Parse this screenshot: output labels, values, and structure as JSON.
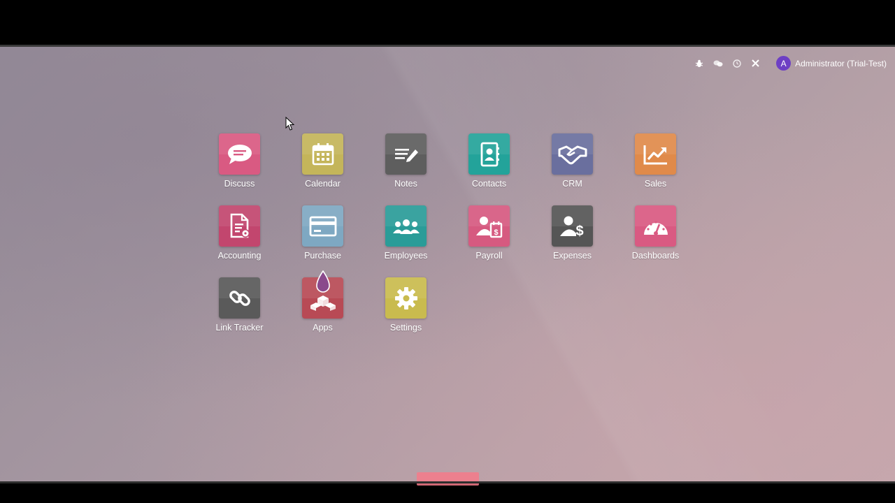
{
  "systray": {
    "icons": [
      "bug-icon",
      "chat-icon",
      "clock-icon",
      "close-icon"
    ],
    "user": {
      "initial": "A",
      "name": "Administrator (Trial-Test)",
      "avatar_color": "#6d3fc4"
    }
  },
  "apps": [
    {
      "label": "Discuss",
      "icon": "discuss-icon",
      "color": "#d95a82"
    },
    {
      "label": "Calendar",
      "icon": "calendar-icon",
      "color": "#c4b55a"
    },
    {
      "label": "Notes",
      "icon": "notes-icon",
      "color": "#5e5e5e"
    },
    {
      "label": "Contacts",
      "icon": "contacts-icon",
      "color": "#23a39a"
    },
    {
      "label": "CRM",
      "icon": "handshake-icon",
      "color": "#6a6f9e"
    },
    {
      "label": "Sales",
      "icon": "sales-chart-icon",
      "color": "#e08a4a"
    },
    {
      "label": "Accounting",
      "icon": "accounting-doc-icon",
      "color": "#c2466e"
    },
    {
      "label": "Purchase",
      "icon": "credit-card-icon",
      "color": "#7ea8c2"
    },
    {
      "label": "Employees",
      "icon": "employees-icon",
      "color": "#2a9c98"
    },
    {
      "label": "Payroll",
      "icon": "payroll-icon",
      "color": "#d65a80"
    },
    {
      "label": "Expenses",
      "icon": "expenses-icon",
      "color": "#555555"
    },
    {
      "label": "Dashboards",
      "icon": "gauge-icon",
      "color": "#d95a82"
    },
    {
      "label": "Link Tracker",
      "icon": "link-icon",
      "color": "#5a5a5a"
    },
    {
      "label": "Apps",
      "icon": "cubes-icon",
      "color": "#b84a55"
    },
    {
      "label": "Settings",
      "icon": "gear-icon",
      "color": "#c9bb4e"
    }
  ]
}
